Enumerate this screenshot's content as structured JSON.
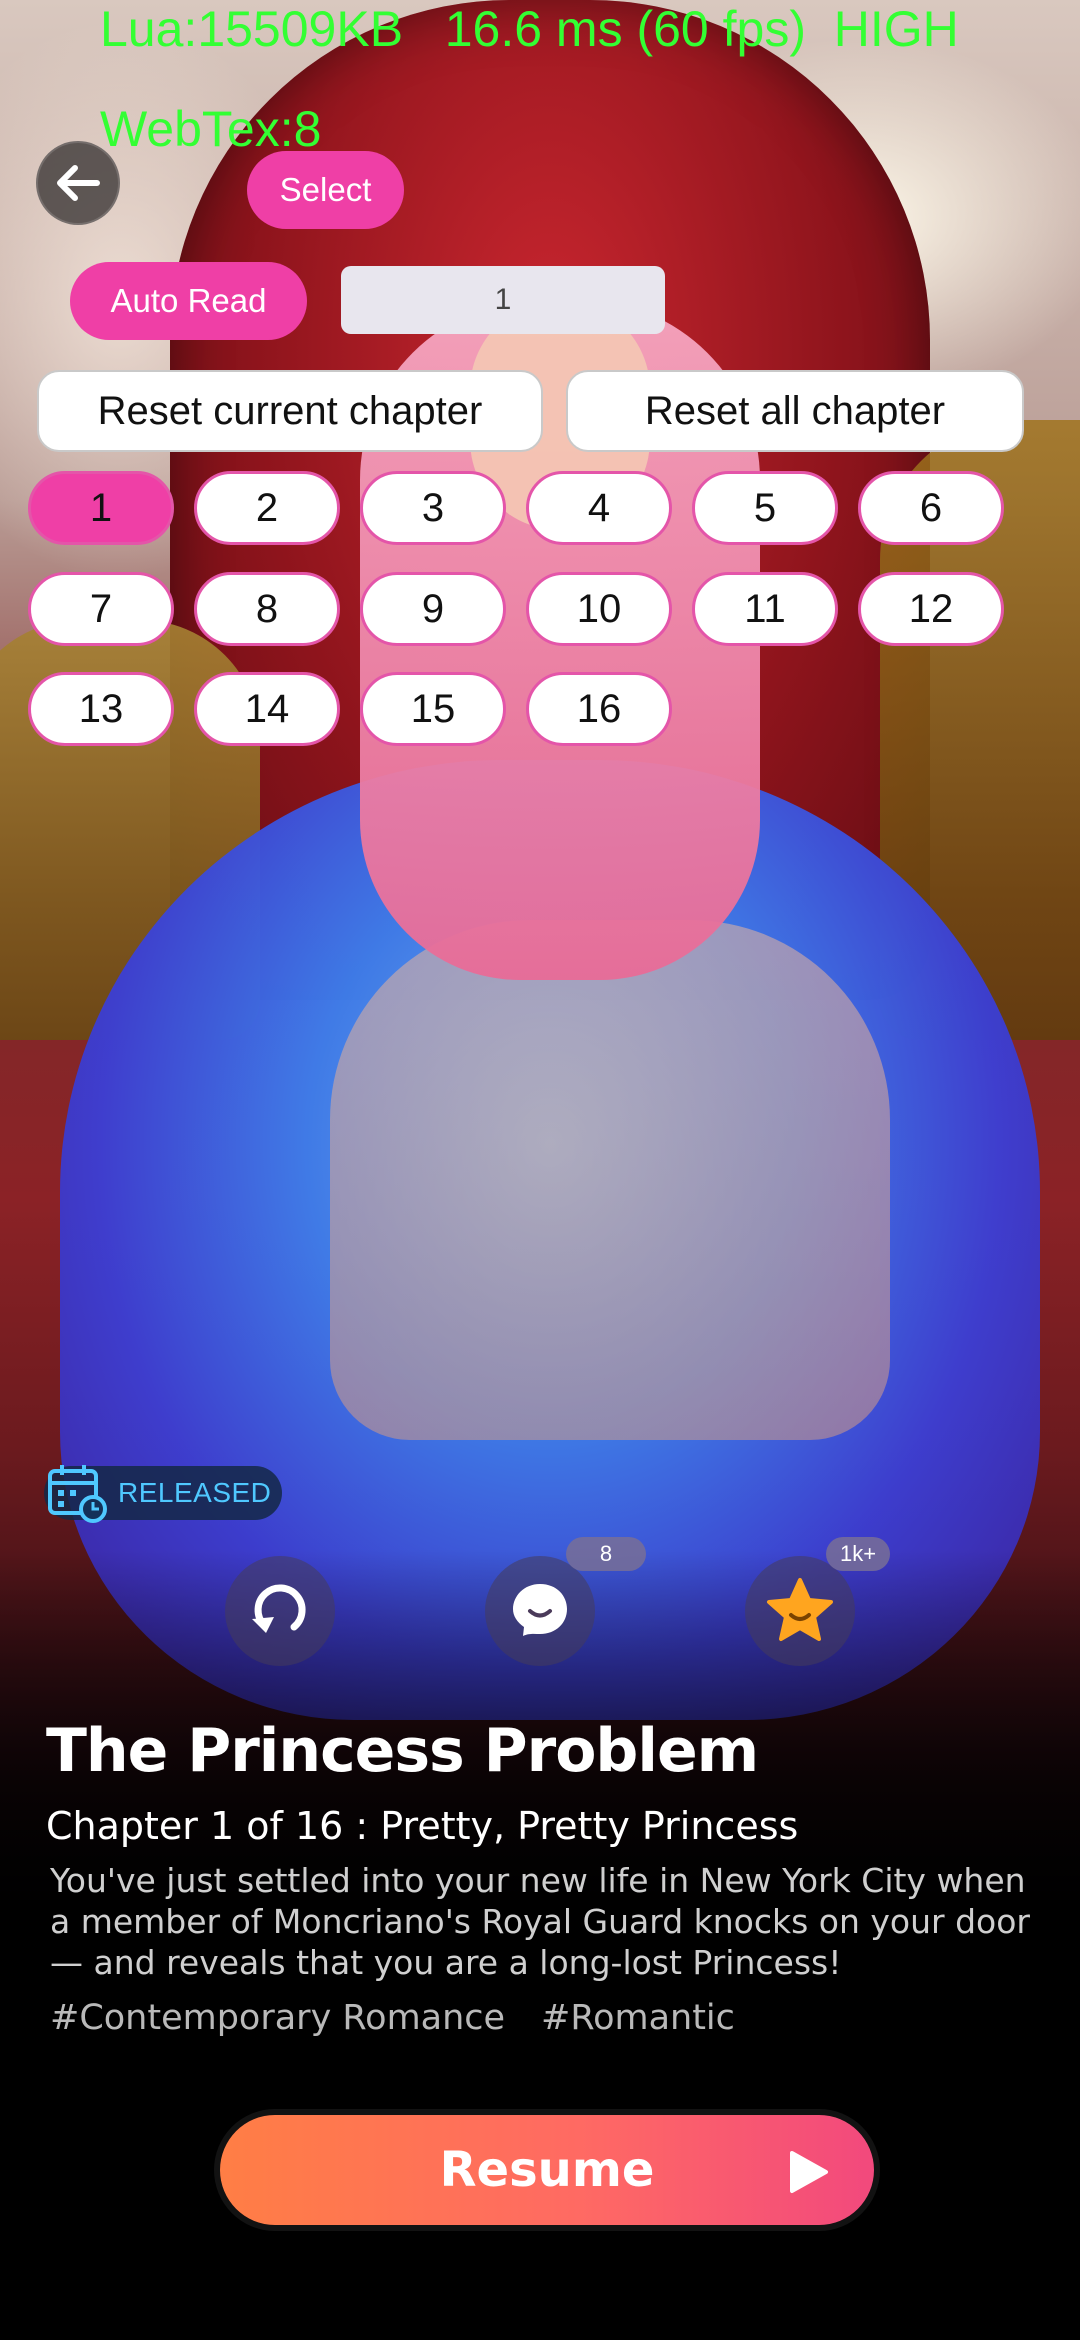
{
  "debug": {
    "line1": "Lua:15509KB   16.6 ms (60 fps)  HIGH",
    "line2": "WebTex:8"
  },
  "controls": {
    "back_icon": "arrow-left-icon",
    "select_label": "Select",
    "auto_read_label": "Auto Read",
    "page_input_value": "1",
    "reset_current_label": "Reset current chapter",
    "reset_all_label": "Reset all chapter"
  },
  "chapters": {
    "items": [
      "1",
      "2",
      "3",
      "4",
      "5",
      "6",
      "7",
      "8",
      "9",
      "10",
      "11",
      "12",
      "13",
      "14",
      "15",
      "16"
    ],
    "active": "1"
  },
  "badge": {
    "released_label": "RELEASED",
    "icon": "calendar-clock-icon",
    "color": "#4fc8ff"
  },
  "actions": {
    "replay_icon": "replay-icon",
    "comment_icon": "comment-icon",
    "comment_count": "8",
    "favorite_icon": "star-icon",
    "favorite_count": "1k+"
  },
  "story": {
    "title": "The Princess Problem",
    "chapter_line": "Chapter 1  of  16 : Pretty, Pretty Princess",
    "description": "You've just settled into your new life in New York City when a member of Moncriano's Royal Guard knocks on your door— and reveals that you are a long-lost Princess!",
    "tags": [
      "#Contemporary Romance",
      "#Romantic"
    ]
  },
  "resume": {
    "label": "Resume",
    "icon": "play-icon"
  },
  "colors": {
    "accent_pink": "#ef3fa6",
    "resume_start": "#ff7e45",
    "resume_end": "#f2497d",
    "debug_green": "#33ff33"
  }
}
